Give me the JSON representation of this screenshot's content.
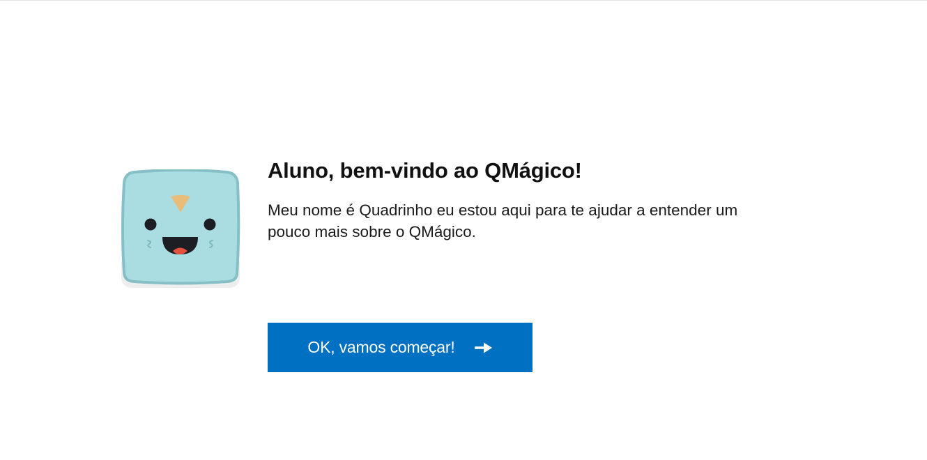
{
  "welcome": {
    "title": "Aluno, bem-vindo ao QMágico!",
    "message": "Meu nome é Quadrinho eu estou aqui para te ajudar a entender um pouco mais sobre o QMágico.",
    "mascot_icon": "quadrinho-mascot-icon",
    "cta_label": "OK, vamos começar!",
    "cta_icon": "arrow-right-icon"
  },
  "colors": {
    "accent": "#0070c3",
    "mascot_body": "#a9dde2",
    "mascot_outline": "#86c0c6",
    "mascot_shadow": "#eeeeee",
    "mascot_nose": "#e8bd7a",
    "mascot_tongue": "#e2513b"
  }
}
